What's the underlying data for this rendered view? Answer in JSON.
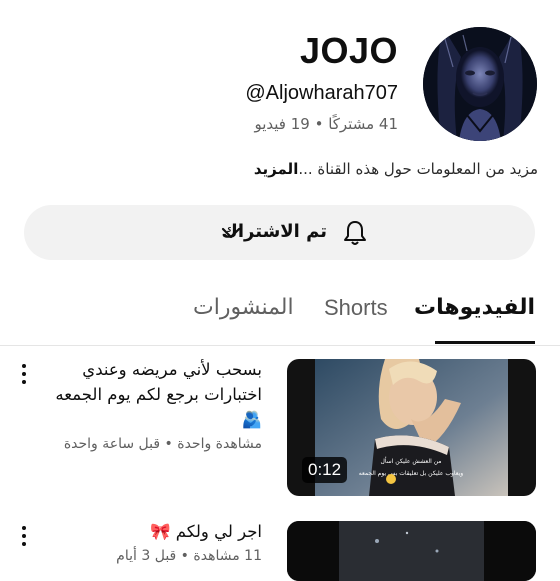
{
  "channel": {
    "name": "JOJO",
    "handle": "@Aljowharah707",
    "stats": "41 مشتركًا • 19 فيديو",
    "about": "مزيد من المعلومات حول هذه القناة ...",
    "about_more": "المزيد",
    "avatar_icon": "channel-avatar-photo"
  },
  "subscribe": {
    "label": "تم الاشتراك",
    "bell_icon": "bell-icon",
    "chevron_icon": "chevron-down-icon"
  },
  "tabs": [
    {
      "label": "الفيديوهات",
      "active": true
    },
    {
      "label": "Shorts",
      "active": false
    },
    {
      "label": "المنشورات",
      "active": false
    }
  ],
  "videos": [
    {
      "title": "بسحب لأني مريضه وعندي اختبارات برجع لكم يوم الجمعه🫂",
      "meta": "مشاهدة واحدة • قبل ساعة واحدة",
      "duration": "0:12",
      "thumb_caption_1": "من العشش عليكن اسأل",
      "thumb_caption_2": "ويعاوب عليكن بل تعليقات بس يوم الجمعه"
    },
    {
      "title": "اجر لي ولكم 🎀",
      "meta": "11 مشاهدة • قبل 3 أيام",
      "duration": ""
    }
  ],
  "colors": {
    "text_primary": "#0f0f0f",
    "text_secondary": "#606060",
    "pill_bg": "#f2f2f2",
    "avatar_bg": "#0a0f1d"
  }
}
